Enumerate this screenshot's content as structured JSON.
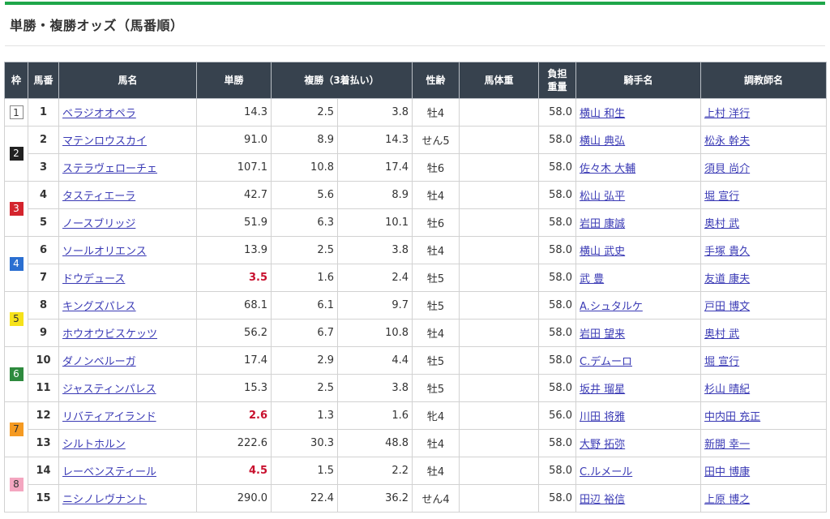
{
  "page": {
    "title": "単勝・複勝オッズ（馬番順）"
  },
  "colors": {
    "accent": "#1ea64a",
    "header_bg": "#37424e",
    "favorite_red": "#c8102e",
    "link": "#3a3ab5",
    "waku": {
      "1": {
        "bg": "#ffffff",
        "fg": "#333333",
        "border": "#888888"
      },
      "2": {
        "bg": "#222222",
        "fg": "#ffffff"
      },
      "3": {
        "bg": "#d4242d",
        "fg": "#ffffff"
      },
      "4": {
        "bg": "#2b6fd1",
        "fg": "#ffffff"
      },
      "5": {
        "bg": "#f6e21a",
        "fg": "#333333"
      },
      "6": {
        "bg": "#2e8a3e",
        "fg": "#ffffff"
      },
      "7": {
        "bg": "#f59a22",
        "fg": "#333333"
      },
      "8": {
        "bg": "#f4a6c0",
        "fg": "#333333"
      }
    }
  },
  "table": {
    "headers": {
      "waku": "枠",
      "umaban": "馬番",
      "horse": "馬名",
      "win": "単勝",
      "place": "複勝（3着払い）",
      "sexage": "性齢",
      "weight": "馬体重",
      "burden_1": "負担",
      "burden_2": "重量",
      "jockey": "騎手名",
      "trainer": "調教師名"
    },
    "rows": [
      {
        "waku": "1",
        "num": "1",
        "horse": "ベラジオオペラ",
        "win": "14.3",
        "pl_lo": "2.5",
        "pl_hi": "3.8",
        "sexage": "牡4",
        "weight": "",
        "burden": "58.0",
        "jockey": "横山 和生",
        "trainer": "上村 洋行",
        "fav": false
      },
      {
        "waku": "2",
        "num": "2",
        "horse": "マテンロウスカイ",
        "win": "91.0",
        "pl_lo": "8.9",
        "pl_hi": "14.3",
        "sexage": "せん5",
        "weight": "",
        "burden": "58.0",
        "jockey": "横山 典弘",
        "trainer": "松永 幹夫",
        "fav": false
      },
      {
        "waku": "",
        "num": "3",
        "horse": "ステラヴェローチェ",
        "win": "107.1",
        "pl_lo": "10.8",
        "pl_hi": "17.4",
        "sexage": "牡6",
        "weight": "",
        "burden": "58.0",
        "jockey": "佐々木 大輔",
        "trainer": "須貝 尚介",
        "fav": false
      },
      {
        "waku": "3",
        "num": "4",
        "horse": "タスティエーラ",
        "win": "42.7",
        "pl_lo": "5.6",
        "pl_hi": "8.9",
        "sexage": "牡4",
        "weight": "",
        "burden": "58.0",
        "jockey": "松山 弘平",
        "trainer": "堀 宣行",
        "fav": false
      },
      {
        "waku": "",
        "num": "5",
        "horse": "ノースブリッジ",
        "win": "51.9",
        "pl_lo": "6.3",
        "pl_hi": "10.1",
        "sexage": "牡6",
        "weight": "",
        "burden": "58.0",
        "jockey": "岩田 康誠",
        "trainer": "奥村 武",
        "fav": false
      },
      {
        "waku": "4",
        "num": "6",
        "horse": "ソールオリエンス",
        "win": "13.9",
        "pl_lo": "2.5",
        "pl_hi": "3.8",
        "sexage": "牡4",
        "weight": "",
        "burden": "58.0",
        "jockey": "横山 武史",
        "trainer": "手塚 貴久",
        "fav": false
      },
      {
        "waku": "",
        "num": "7",
        "horse": "ドウデュース",
        "win": "3.5",
        "pl_lo": "1.6",
        "pl_hi": "2.4",
        "sexage": "牡5",
        "weight": "",
        "burden": "58.0",
        "jockey": "武 豊",
        "trainer": "友道 康夫",
        "fav": true
      },
      {
        "waku": "5",
        "num": "8",
        "horse": "キングズパレス",
        "win": "68.1",
        "pl_lo": "6.1",
        "pl_hi": "9.7",
        "sexage": "牡5",
        "weight": "",
        "burden": "58.0",
        "jockey": "A.シュタルケ",
        "trainer": "戸田 博文",
        "fav": false
      },
      {
        "waku": "",
        "num": "9",
        "horse": "ホウオウビスケッツ",
        "win": "56.2",
        "pl_lo": "6.7",
        "pl_hi": "10.8",
        "sexage": "牡4",
        "weight": "",
        "burden": "58.0",
        "jockey": "岩田 望来",
        "trainer": "奥村 武",
        "fav": false
      },
      {
        "waku": "6",
        "num": "10",
        "horse": "ダノンベルーガ",
        "win": "17.4",
        "pl_lo": "2.9",
        "pl_hi": "4.4",
        "sexage": "牡5",
        "weight": "",
        "burden": "58.0",
        "jockey": "C.デムーロ",
        "trainer": "堀 宣行",
        "fav": false
      },
      {
        "waku": "",
        "num": "11",
        "horse": "ジャスティンパレス",
        "win": "15.3",
        "pl_lo": "2.5",
        "pl_hi": "3.8",
        "sexage": "牡5",
        "weight": "",
        "burden": "58.0",
        "jockey": "坂井 瑠星",
        "trainer": "杉山 晴紀",
        "fav": false
      },
      {
        "waku": "7",
        "num": "12",
        "horse": "リバティアイランド",
        "win": "2.6",
        "pl_lo": "1.3",
        "pl_hi": "1.6",
        "sexage": "牝4",
        "weight": "",
        "burden": "56.0",
        "jockey": "川田 将雅",
        "trainer": "中内田 充正",
        "fav": true
      },
      {
        "waku": "",
        "num": "13",
        "horse": "シルトホルン",
        "win": "222.6",
        "pl_lo": "30.3",
        "pl_hi": "48.8",
        "sexage": "牡4",
        "weight": "",
        "burden": "58.0",
        "jockey": "大野 拓弥",
        "trainer": "新開 幸一",
        "fav": false
      },
      {
        "waku": "8",
        "num": "14",
        "horse": "レーベンスティール",
        "win": "4.5",
        "pl_lo": "1.5",
        "pl_hi": "2.2",
        "sexage": "牡4",
        "weight": "",
        "burden": "58.0",
        "jockey": "C.ルメール",
        "trainer": "田中 博康",
        "fav": true
      },
      {
        "waku": "",
        "num": "15",
        "horse": "ニシノレヴナント",
        "win": "290.0",
        "pl_lo": "22.4",
        "pl_hi": "36.2",
        "sexage": "せん4",
        "weight": "",
        "burden": "58.0",
        "jockey": "田辺 裕信",
        "trainer": "上原 博之",
        "fav": false
      }
    ],
    "waku_spans": {
      "1": 1,
      "2": 2,
      "3": 2,
      "4": 2,
      "5": 2,
      "6": 2,
      "7": 2,
      "8": 2
    }
  }
}
